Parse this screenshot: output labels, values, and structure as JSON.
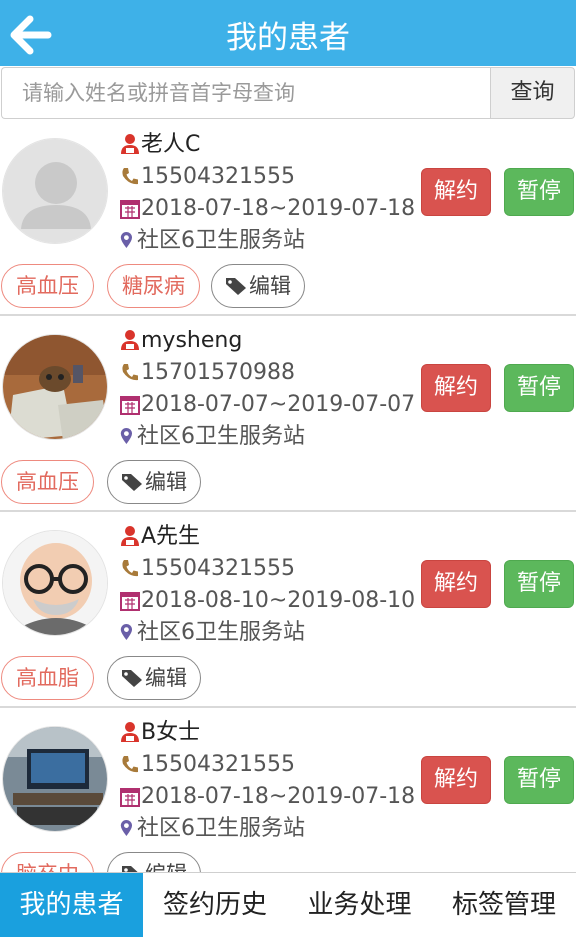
{
  "header": {
    "title": "我的患者"
  },
  "search": {
    "placeholder": "请输入姓名或拼音首字母查询",
    "button_label": "查询"
  },
  "patients": [
    {
      "name": "老人C",
      "phone": "15504321555",
      "period": "2018-07-18~2019-07-18",
      "station": "社区6卫生服务站",
      "tags": [
        "高血压",
        "糖尿病"
      ],
      "edit_label": "编辑",
      "cancel_label": "解约",
      "pause_label": "暂停"
    },
    {
      "name": "mysheng",
      "phone": "15701570988",
      "period": "2018-07-07~2019-07-07",
      "station": "社区6卫生服务站",
      "tags": [
        "高血压"
      ],
      "edit_label": "编辑",
      "cancel_label": "解约",
      "pause_label": "暂停"
    },
    {
      "name": "A先生",
      "phone": "15504321555",
      "period": "2018-08-10~2019-08-10",
      "station": "社区6卫生服务站",
      "tags": [
        "高血脂"
      ],
      "edit_label": "编辑",
      "cancel_label": "解约",
      "pause_label": "暂停"
    },
    {
      "name": "B女士",
      "phone": "15504321555",
      "period": "2018-07-18~2019-07-18",
      "station": "社区6卫生服务站",
      "tags": [
        "脑卒中"
      ],
      "edit_label": "编辑",
      "cancel_label": "解约",
      "pause_label": "暂停"
    }
  ],
  "tabs": [
    {
      "label": "我的患者",
      "active": true
    },
    {
      "label": "签约历史",
      "active": false
    },
    {
      "label": "业务处理",
      "active": false
    },
    {
      "label": "标签管理",
      "active": false
    }
  ],
  "colors": {
    "header": "#3eb1e8",
    "active_tab": "#1aa0de",
    "cancel": "#d9534f",
    "pause": "#5cb85c",
    "tag_border": "#ee8a7f"
  },
  "icons": [
    "back-arrow-icon",
    "user-icon",
    "phone-icon",
    "calendar-icon",
    "location-icon",
    "tag-icon"
  ]
}
